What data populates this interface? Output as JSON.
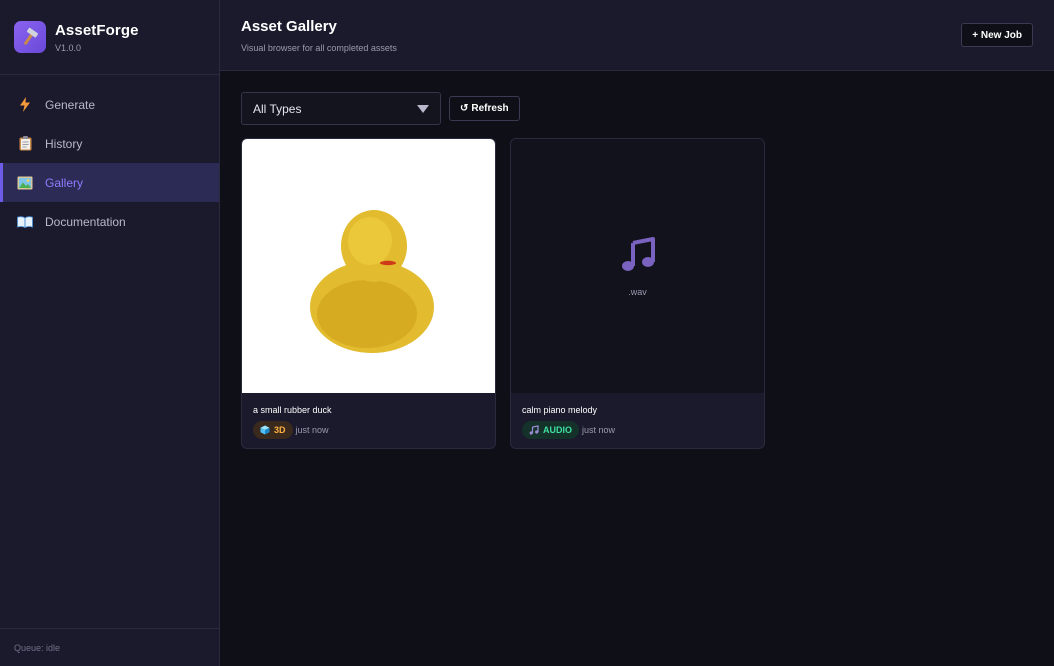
{
  "brand": {
    "name": "AssetForge",
    "version": "V1.0.0"
  },
  "nav": {
    "items": [
      {
        "label": "Generate",
        "icon": "lightning-icon"
      },
      {
        "label": "History",
        "icon": "clipboard-icon"
      },
      {
        "label": "Gallery",
        "icon": "picture-icon",
        "active": true
      },
      {
        "label": "Documentation",
        "icon": "book-icon"
      }
    ]
  },
  "queue": {
    "status": "Queue: idle"
  },
  "header": {
    "title": "Asset Gallery",
    "subtitle": "Visual browser for all completed assets",
    "new_job_label": "+ New Job"
  },
  "toolbar": {
    "filter_value": "All Types",
    "refresh_label": "Refresh"
  },
  "assets": [
    {
      "title": "a small rubber duck",
      "type": "3D",
      "time": "just now",
      "preview": "duck-image"
    },
    {
      "title": "calm piano melody",
      "type": "AUDIO",
      "time": "just now",
      "preview": "music-note-icon",
      "extension": ".wav"
    }
  ],
  "colors": {
    "accent": "#6c5ce7",
    "badge_3d": "#ffb13d",
    "badge_audio": "#3fe0a0",
    "background": "#0f0f17",
    "panel": "#1a1a2c"
  }
}
